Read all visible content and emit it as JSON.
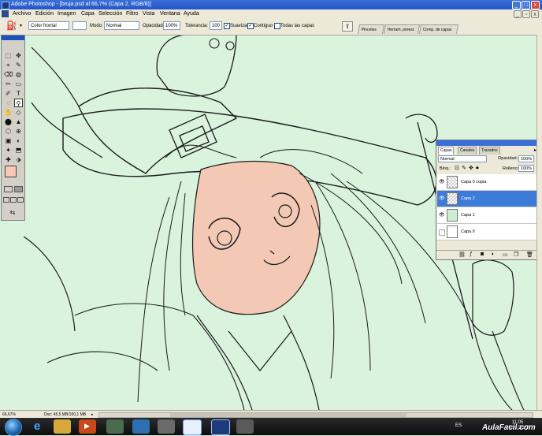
{
  "window": {
    "title": "Adobe Photoshop - [bruja.psd al 66,7% (Capa 2, RGB/8)]",
    "min_label": "_",
    "max_label": "□",
    "close_label": "x"
  },
  "menu": {
    "items": [
      "Archivo",
      "Edición",
      "Imagen",
      "Capa",
      "Selección",
      "Filtro",
      "Vista",
      "Ventana",
      "Ayuda"
    ]
  },
  "options_bar": {
    "source_value": "Color frontal",
    "mode_label": "Modo:",
    "mode_value": "Normal",
    "opacity_label": "Opacidad:",
    "opacity_value": "100%",
    "tolerance_label": "Tolerancia:",
    "tolerance_value": "100",
    "smooth_label": "Suavizar",
    "contiguous_label": "Contiguo",
    "all_layers_label": "Todas las capas",
    "smooth_checked": true,
    "contiguous_checked": true,
    "all_layers_checked": false,
    "palette_tabs": [
      "Pinceles",
      "Herram. preest.",
      "Comp. de capas"
    ]
  },
  "toolbox": {
    "tools": [
      "⬚",
      "✥",
      "⌖",
      "✎",
      "⌫",
      "◍",
      "✂",
      "▭",
      "✐",
      "T",
      "◌",
      "⚲",
      "✋",
      "◇",
      "⬤",
      "▲",
      "⬡",
      "⊕",
      "▣",
      "◐",
      "✦",
      "⬒",
      "✚",
      "⬗"
    ]
  },
  "layers_panel": {
    "tabs": [
      "Capas",
      "Canales",
      "Trazados"
    ],
    "blend_mode": "Normal",
    "opacity_label": "Opacidad:",
    "opacity_value": "100%",
    "lock_label": "Bloq.:",
    "fill_label": "Relleno:",
    "fill_value": "100%",
    "layers": [
      {
        "name": "Capa 0 copia",
        "visible": true,
        "active": false
      },
      {
        "name": "Capa 2",
        "visible": true,
        "active": true
      },
      {
        "name": "Capa 1",
        "visible": true,
        "active": false
      },
      {
        "name": "Capa 0",
        "visible": false,
        "active": false
      }
    ]
  },
  "status_bar": {
    "zoom": "66,67%",
    "doc_info": "Doc: 45,5 MB/100,1 MB"
  },
  "taskbar": {
    "language": "ES",
    "time": "11:05",
    "date": "29/01/2012"
  },
  "watermark": "AulaFacil.com",
  "colors": {
    "canvas_bg": "#d9f3dc",
    "skin_fill": "#f3c9b5",
    "foreground": "#f6c8b6",
    "active_layer": "#3d7bd9"
  }
}
